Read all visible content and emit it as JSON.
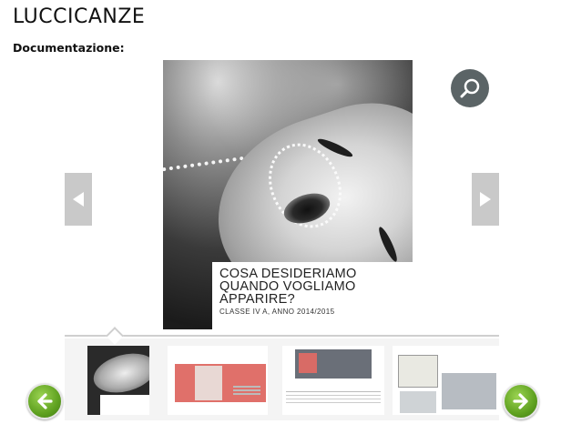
{
  "page": {
    "title": "LUCCICANZE",
    "documentation_label": "Documentazione:"
  },
  "slide": {
    "caption_line1": "COSA DESIDERIAMO",
    "caption_line2": "QUANDO VOGLIAMO",
    "caption_line3": "APPARIRE?",
    "caption_sub": "CLASSE IV A, ANNO 2014/2015"
  },
  "controls": {
    "zoom_icon": "magnifier-icon",
    "prev_icon": "triangle-left-icon",
    "next_icon": "triangle-right-icon",
    "strip_prev_icon": "green-arrow-left-icon",
    "strip_next_icon": "green-arrow-right-icon"
  },
  "thumbnails": {
    "selected_index": 0
  },
  "colors": {
    "zoom_button": "#5b6466",
    "arrow_button": "#c9c9c9",
    "strip_nav_green": "#5fa120",
    "thumb_accent_red": "#e0706a"
  }
}
